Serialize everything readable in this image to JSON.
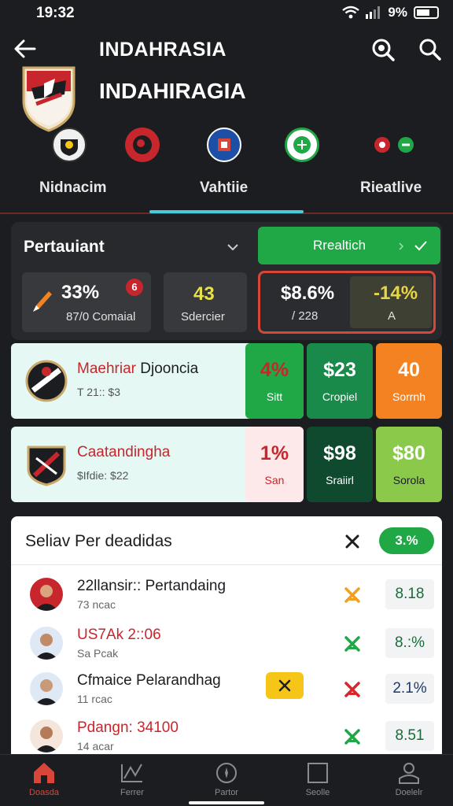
{
  "status": {
    "time": "19:32",
    "battery": "9%"
  },
  "header": {
    "title": "INDAHRASIA",
    "team_name": "INDAHIRAGIA"
  },
  "tabs": [
    {
      "label": "Nidnacim"
    },
    {
      "label": "Vahtiie"
    },
    {
      "label": "Rieatlive"
    }
  ],
  "panel": {
    "title": "Pertauiant",
    "realtime_label": "Rrealtich",
    "stats": [
      {
        "value": "33%",
        "sub": "87/0 Comaial"
      },
      {
        "value": "43",
        "sub": "Sdercier"
      },
      {
        "value": "$8.6%",
        "sub": "/ 228",
        "value2": "-14%",
        "sub2": "A"
      }
    ],
    "badge": "6"
  },
  "matches": [
    {
      "title_red": "Maehriar",
      "title_dark": "Djooncia",
      "sub": "T 21:: $3",
      "odds": [
        {
          "value": "4%",
          "label": "Sitt"
        },
        {
          "value": "$23",
          "label": "Cropiel"
        },
        {
          "value": "40",
          "label": "Sorrnh"
        }
      ]
    },
    {
      "title_red": "Caatandingha",
      "title_dark": "",
      "sub": "$Ifdie: $22",
      "odds": [
        {
          "value": "1%",
          "label": "San"
        },
        {
          "value": "$98",
          "label": "Sraiirl"
        },
        {
          "value": "$80",
          "label": "Sorola"
        }
      ]
    }
  ],
  "list": {
    "title": "Seliav Per deadidas",
    "badge": "3.%",
    "rows": [
      {
        "title": "22llansir:: Pertandaing",
        "sub": "73 ncac",
        "odd": "8.18"
      },
      {
        "title": "US7Ak 2::06",
        "sub": "Sa Pcak",
        "odd": "8.:%"
      },
      {
        "title": "Cfmaice Pelarandhag",
        "sub": "11 rcac",
        "odd": "2.1%"
      },
      {
        "title": "Pdangn: 34100",
        "sub": "14 acar",
        "odd": "8.51"
      }
    ]
  },
  "nav": [
    {
      "label": "Doasda"
    },
    {
      "label": "Ferrer"
    },
    {
      "label": "Partor"
    },
    {
      "label": "Seolle"
    },
    {
      "label": "Doelelr"
    }
  ],
  "colors": {
    "accent": "#1fa845",
    "danger": "#d8463a",
    "tab_indicator": "#4dc8d8",
    "warning": "#f58220"
  }
}
